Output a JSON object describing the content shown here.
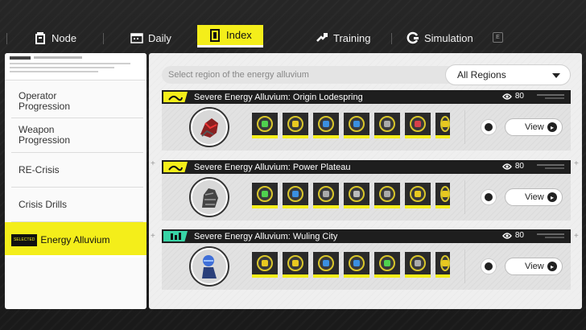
{
  "tabs": [
    {
      "label": "Node",
      "icon": "node-icon",
      "active": false
    },
    {
      "label": "Daily",
      "icon": "calendar-icon",
      "active": false
    },
    {
      "label": "Index",
      "icon": "index-icon",
      "active": true
    },
    {
      "label": "Training",
      "icon": "training-icon",
      "active": false
    },
    {
      "label": "Simulation",
      "icon": "simulation-icon",
      "active": false
    }
  ],
  "tab_key_hint": "E",
  "sidebar": {
    "items": [
      {
        "label": "Operator\nProgression"
      },
      {
        "label": "Weapon\nProgression"
      },
      {
        "label": "RE-Crisis"
      },
      {
        "label": "Crisis Drills"
      },
      {
        "label": "Energy Alluvium",
        "tag": "SELECTED"
      }
    ]
  },
  "filter": {
    "prompt": "Select region of the energy alluvium",
    "selected": "All Regions"
  },
  "regions": [
    {
      "title": "Severe Energy Alluvium: Origin Lodespring",
      "cost": "80",
      "badge_color": "#f4ee1a",
      "view_label": "View"
    },
    {
      "title": "Severe Energy Alluvium: Power Plateau",
      "cost": "80",
      "badge_color": "#f4ee1a",
      "view_label": "View"
    },
    {
      "title": "Severe Energy Alluvium: Wuling City",
      "cost": "80",
      "badge_color": "#38d4a6",
      "view_label": "View"
    }
  ],
  "colors": {
    "accent": "#f4ee1a",
    "teal": "#38d4a6",
    "dark": "#1e1e1e"
  }
}
